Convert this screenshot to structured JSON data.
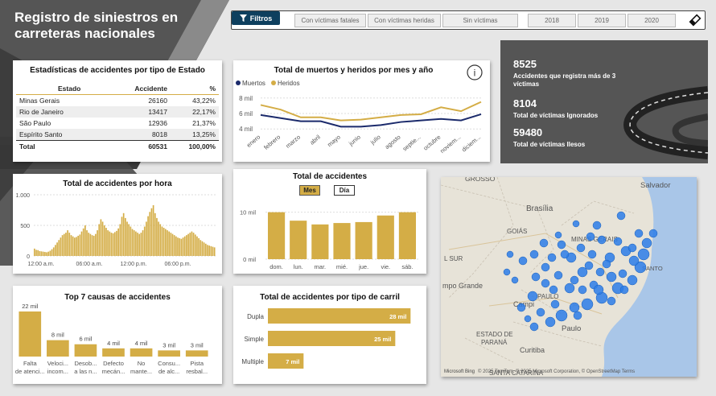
{
  "app_title": "Registro de siniestros en carreteras nacionales",
  "toolbar": {
    "filter_label": "Filtros",
    "filters": [
      "Con víctimas fatales",
      "Con víctimas heridas",
      "Sin víctimas"
    ],
    "years": [
      "2018",
      "2019",
      "2020"
    ]
  },
  "state_table": {
    "title": "Estadísticas de accidentes por tipo de Estado",
    "headers": [
      "Estado",
      "Accidente",
      "%"
    ],
    "rows": [
      [
        "Minas Gerais",
        "26160",
        "43,22%"
      ],
      [
        "Rio de Janeiro",
        "13417",
        "22,17%"
      ],
      [
        "São Paulo",
        "12936",
        "21,37%"
      ],
      [
        "Espírito Santo",
        "8018",
        "13,25%"
      ]
    ],
    "total": [
      "Total",
      "60531",
      "100,00%"
    ]
  },
  "line_chart": {
    "title": "Total de muertos y heridos por mes y año",
    "info_icon": "info-icon"
  },
  "kpi": {
    "v1": "8525",
    "l1": "Accidentes que registra más de 3 víctimas",
    "v2": "8104",
    "l2": "Total de víctimas Ignorados",
    "v3": "59480",
    "l3": "Total de víctimas Ilesos"
  },
  "hour_chart": {
    "title": "Total de accidentes por hora"
  },
  "day_chart": {
    "title": "Total de accidentes",
    "toggle_mes": "Mes",
    "toggle_dia": "Día"
  },
  "causes_chart": {
    "title": "Top 7 causas de accidentes"
  },
  "lane_chart": {
    "title": "Total de accidentes por tipo de carril"
  },
  "map": {
    "labels": [
      "GROSSO",
      "Salvador",
      "Brasília",
      "GOIÁS",
      "MINAS GERAIS",
      "SANTO",
      "L SUR",
      "mpo Grande",
      "PAULO",
      "Campi",
      "Paulo",
      "ESTADO DE",
      "PARANÁ",
      "Curitiba",
      "SANTA CATARINA"
    ],
    "credits": "© 2025 TomTom, © 2025 Microsoft Corporation, © OpenStreetMap Terms",
    "provider": "Microsoft Bing"
  },
  "chart_data": [
    {
      "type": "line",
      "title": "Total de muertos y heridos por mes y año",
      "categories": [
        "enero",
        "febrero",
        "marzo",
        "abril",
        "mayo",
        "junio",
        "julio",
        "agosto",
        "septie...",
        "octubre",
        "noviem...",
        "diciem..."
      ],
      "series": [
        {
          "name": "Muertos",
          "color": "#1b2a6b",
          "values": [
            5800,
            5400,
            5000,
            5000,
            4300,
            4300,
            4500,
            4900,
            5100,
            5300,
            5100,
            5900
          ]
        },
        {
          "name": "Heridos",
          "color": "#d4ad46",
          "values": [
            7100,
            6500,
            5500,
            5500,
            5100,
            5200,
            5500,
            5800,
            5900,
            6800,
            6300,
            7500
          ]
        }
      ],
      "yticks": [
        "4 mil",
        "6 mil",
        "8 mil"
      ],
      "ylim": [
        3500,
        8500
      ]
    },
    {
      "type": "bar",
      "title": "Total de accidentes por hora",
      "color": "#d4ad46",
      "x": [
        "12:00 a.m.",
        "06:00 a.m.",
        "12:00 p.m.",
        "06:00 p.m."
      ],
      "yticks": [
        "0",
        "500",
        "1.000"
      ],
      "ylim": [
        0,
        1000
      ],
      "values": [
        120,
        100,
        95,
        80,
        75,
        70,
        65,
        60,
        70,
        85,
        110,
        140,
        180,
        220,
        260,
        300,
        340,
        360,
        380,
        420,
        380,
        340,
        320,
        300,
        310,
        330,
        350,
        400,
        450,
        500,
        420,
        380,
        360,
        340,
        330,
        360,
        420,
        520,
        600,
        560,
        500,
        460,
        420,
        400,
        380,
        370,
        390,
        410,
        450,
        520,
        640,
        700,
        620,
        560,
        520,
        480,
        440,
        420,
        400,
        380,
        360,
        380,
        420,
        480,
        560,
        650,
        720,
        780,
        830,
        700,
        620,
        560,
        520,
        480,
        460,
        440,
        420,
        400,
        380,
        360,
        340,
        320,
        300,
        290,
        280,
        300,
        320,
        340,
        360,
        380,
        400,
        380,
        350,
        320,
        290,
        260,
        240,
        220,
        200,
        180,
        170,
        160,
        150,
        140
      ]
    },
    {
      "type": "bar",
      "title": "Total de accidentes",
      "color": "#d4ad46",
      "categories": [
        "dom.",
        "lun.",
        "mar.",
        "mié.",
        "jue.",
        "vie.",
        "sáb."
      ],
      "values": [
        10000,
        8200,
        7400,
        7700,
        7900,
        9300,
        10000
      ],
      "yticks": [
        "0 mil",
        "10 mil"
      ],
      "ylim": [
        0,
        12000
      ]
    },
    {
      "type": "bar",
      "title": "Top 7 causas de accidentes",
      "color": "#d4ad46",
      "categories": [
        "Falta de atenci...",
        "Veloci... incom...",
        "Desob... a las n...",
        "Defecto mecán...",
        "No mante...",
        "Consu... de alc...",
        "Pista resbal..."
      ],
      "values": [
        22000,
        8000,
        6000,
        4000,
        4000,
        3000,
        3000
      ],
      "labels": [
        "22 mil",
        "8 mil",
        "6 mil",
        "4 mil",
        "4 mil",
        "3 mil",
        "3 mil"
      ]
    },
    {
      "type": "bar",
      "title": "Total de accidentes por tipo de carril",
      "color": "#d4ad46",
      "categories": [
        "Dupla",
        "Simple",
        "Multiple"
      ],
      "values": [
        28000,
        25000,
        7000
      ],
      "labels": [
        "28 mil",
        "25 mil",
        "7 mil"
      ]
    }
  ]
}
